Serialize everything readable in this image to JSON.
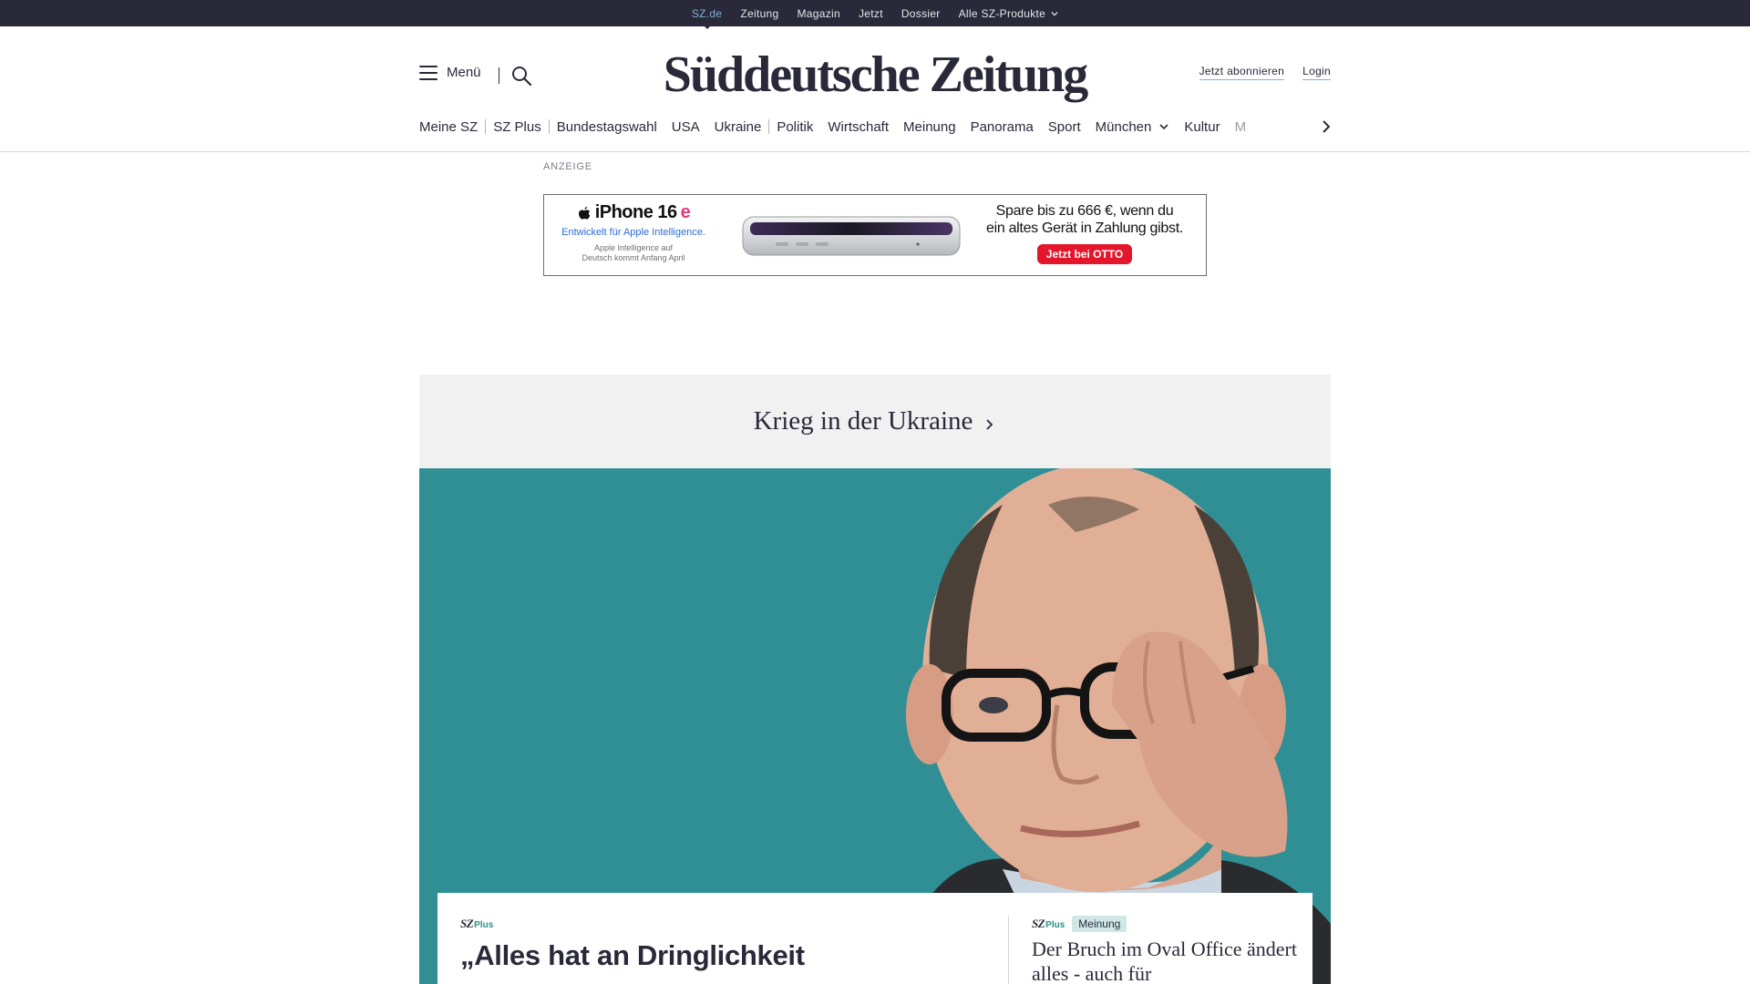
{
  "topbar": {
    "links": [
      {
        "label": "SZ.de",
        "active": true
      },
      {
        "label": "Zeitung"
      },
      {
        "label": "Magazin"
      },
      {
        "label": "Jetzt"
      },
      {
        "label": "Dossier"
      },
      {
        "label": "Alle SZ-Produkte",
        "has_dropdown": true
      }
    ]
  },
  "header": {
    "menu_label": "Menü",
    "logo_text": "Süddeutsche Zeitung",
    "subscribe_label": "Jetzt abonnieren",
    "login_label": "Login"
  },
  "nav": {
    "items": [
      "Meine SZ",
      "SZ Plus",
      "Bundestagswahl",
      "USA",
      "Ukraine",
      "Politik",
      "Wirtschaft",
      "Meinung",
      "Panorama",
      "Sport",
      "München",
      "Kultur",
      "M"
    ]
  },
  "ad": {
    "label": "ANZEIGE",
    "product": "iPhone 16",
    "product_suffix": "e",
    "tagline": "Entwickelt für Apple Intelligence.",
    "note_line1": "Apple Intelligence auf",
    "note_line2": "Deutsch kommt Anfang April",
    "offer_line1": "Spare bis zu 666 €, wenn du",
    "offer_line2": "ein altes Gerät in Zahlung gibst.",
    "cta": "Jetzt bei OTTO"
  },
  "ukraine": {
    "title": "Krieg in der Ukraine"
  },
  "lead": {
    "badge_sz": "SZ",
    "badge_plus": "Plus",
    "title": "„Alles hat an Dringlichkeit"
  },
  "side": {
    "badge_sz": "SZ",
    "badge_plus": "Plus",
    "tag": "Meinung",
    "title": "Der Bruch im Oval Office ändert alles - auch für"
  },
  "colors": {
    "brand_dark": "#29293a",
    "accent_blue": "#7fb3d8",
    "hero_background": "#2f8f94",
    "szplus_green": "#2a8f84",
    "ad_red": "#e3162b"
  }
}
